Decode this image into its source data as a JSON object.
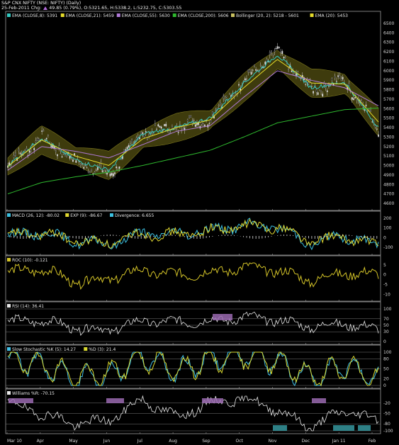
{
  "header": {
    "title": "S&P CNX NIFTY (NSE: NIFTY) (Daily)",
    "date": "25-Feb-2011",
    "chg_label": "Chg:",
    "chg_value": "49.85 (0.79%)",
    "quote": "O:5321.65, H:5338.2, L:5232.75, C:5303.55"
  },
  "colors": {
    "background": "#000000",
    "panel_border": "#9a9a9a",
    "ema8": "#34c8c0",
    "ema21": "#e6dc2a",
    "ema55": "#b07ad8",
    "ema200": "#2eb82e",
    "bollinger_fill": "#45420f",
    "macd": "#3cc0e0",
    "exp": "#e0d830",
    "roc": "#d4c428",
    "rsi_fill": "#9a6ab0",
    "stoch_k": "#40c0e8",
    "stoch_d": "#d8d830",
    "williams_fill": "#9a6ab0"
  },
  "panels": {
    "price": {
      "legend": [
        "EMA (CLOSE,8): 5391",
        "EMA (CLOSE,21): 5459",
        "EMA (CLOSE,55): 5630",
        "EMA (CLOSE,200): 5606",
        "Bollinger (20, 2): 5218 - 5601",
        "EMA (20): 5453"
      ],
      "ticks": [
        "6500",
        "6400",
        "6300",
        "6200",
        "6100",
        "6000",
        "5900",
        "5800",
        "5700",
        "5600",
        "5500",
        "5400",
        "5300",
        "5200",
        "5100",
        "5000",
        "4900",
        "4800",
        "4700",
        "4600"
      ]
    },
    "macd": {
      "legend": [
        "MACD (26, 12): -80.02",
        "EXP (9): -86.67",
        "Divergence: 6.655"
      ],
      "ticks": [
        "200",
        "100",
        "0",
        "-100"
      ]
    },
    "roc": {
      "legend": [
        "ROC (10): -0.121"
      ],
      "ticks": [
        "5",
        "0",
        "-5",
        "-10"
      ]
    },
    "rsi": {
      "legend": [
        "RSI (14): 36.41"
      ],
      "ticks": [
        "100",
        "70",
        "50",
        "30",
        "0"
      ]
    },
    "stoch": {
      "legend": [
        "Slow Stochastic %K (5): 14.27",
        "%D (3): 21.4"
      ],
      "ticks": [
        "100",
        "80",
        "50",
        "20",
        "0"
      ]
    },
    "williams": {
      "legend": [
        "Williams %R: -70.15"
      ],
      "ticks": [
        "-20",
        "-50",
        "-80",
        "-100"
      ]
    }
  },
  "x_axis": [
    "Mar 10",
    "Apr",
    "May",
    "Jun",
    "Jul",
    "Aug",
    "Sep",
    "Oct",
    "Nov",
    "Dec",
    "Jan 11",
    "Feb"
  ],
  "chart_data": [
    {
      "type": "line",
      "title": "S&P CNX NIFTY (NSE: NIFTY) (Daily)",
      "x": [
        "Mar 10",
        "Apr",
        "May",
        "Jun",
        "Jul",
        "Aug",
        "Sep",
        "Oct",
        "Nov",
        "Dec",
        "Jan 11",
        "Feb"
      ],
      "ylim": [
        4600,
        6500
      ],
      "series": [
        {
          "name": "Close",
          "values": [
            5000,
            5300,
            5050,
            4900,
            5350,
            5400,
            5500,
            5900,
            6200,
            5800,
            5900,
            5400
          ]
        },
        {
          "name": "EMA (CLOSE,8)",
          "values": [
            5000,
            5290,
            5060,
            4950,
            5330,
            5400,
            5500,
            5870,
            6170,
            5820,
            5880,
            5400
          ]
        },
        {
          "name": "EMA (CLOSE,21)",
          "values": [
            4990,
            5270,
            5100,
            5000,
            5280,
            5400,
            5480,
            5820,
            6120,
            5870,
            5860,
            5459
          ]
        },
        {
          "name": "EMA (CLOSE,55)",
          "values": [
            4950,
            5200,
            5150,
            5080,
            5220,
            5360,
            5420,
            5720,
            6000,
            5900,
            5820,
            5630
          ]
        },
        {
          "name": "EMA (CLOSE,200)",
          "values": [
            4700,
            4820,
            4880,
            4930,
            5000,
            5080,
            5160,
            5300,
            5450,
            5520,
            5590,
            5606
          ]
        }
      ]
    },
    {
      "type": "line",
      "series": [
        {
          "name": "MACD (26, 12)",
          "values": [
            20,
            60,
            -40,
            -70,
            50,
            30,
            80,
            130,
            110,
            -60,
            20,
            -80
          ]
        },
        {
          "name": "EXP (9)",
          "values": [
            15,
            50,
            -30,
            -60,
            40,
            30,
            70,
            120,
            115,
            -40,
            10,
            -87
          ]
        }
      ],
      "ylim": [
        -150,
        200
      ]
    },
    {
      "type": "line",
      "series": [
        {
          "name": "ROC (10)",
          "values": [
            1,
            3,
            -4,
            -2,
            2,
            0,
            1,
            4,
            2,
            -3,
            1,
            -0.121
          ]
        }
      ],
      "ylim": [
        -12,
        6
      ]
    },
    {
      "type": "line",
      "series": [
        {
          "name": "RSI (14)",
          "values": [
            60,
            65,
            40,
            35,
            62,
            60,
            62,
            75,
            65,
            45,
            55,
            36.41
          ]
        }
      ],
      "ylim": [
        0,
        100
      ]
    },
    {
      "type": "line",
      "series": [
        {
          "name": "Slow Stochastic %K (5)",
          "values": [
            80,
            60,
            20,
            30,
            90,
            40,
            80,
            95,
            70,
            20,
            60,
            14.27
          ]
        },
        {
          "name": "%D (3)",
          "values": [
            75,
            65,
            25,
            35,
            85,
            45,
            75,
            90,
            75,
            25,
            55,
            21.4
          ]
        }
      ],
      "ylim": [
        0,
        100
      ]
    },
    {
      "type": "line",
      "series": [
        {
          "name": "Williams %R",
          "values": [
            -20,
            -50,
            -80,
            -70,
            -10,
            -60,
            -20,
            -5,
            -40,
            -90,
            -40,
            -70.15
          ]
        }
      ],
      "ylim": [
        -100,
        0
      ]
    }
  ]
}
